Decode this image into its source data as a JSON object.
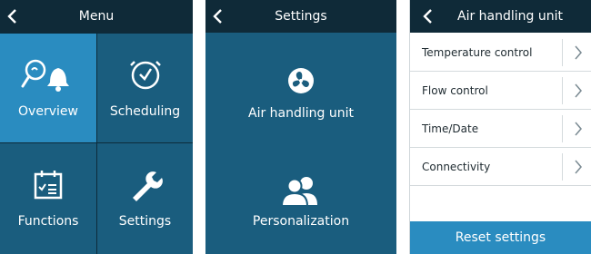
{
  "menu_screen": {
    "title": "Menu",
    "tiles": [
      {
        "label": "Overview",
        "icon": "overview-icon",
        "selected": true
      },
      {
        "label": "Scheduling",
        "icon": "clock-icon"
      },
      {
        "label": "Functions",
        "icon": "calendar-list-icon"
      },
      {
        "label": "Settings",
        "icon": "wrench-icon"
      }
    ]
  },
  "settings_screen": {
    "title": "Settings",
    "tiles": [
      {
        "label": "Air handling unit",
        "icon": "fan-icon"
      },
      {
        "label": "Personalization",
        "icon": "users-icon"
      }
    ]
  },
  "ahu_screen": {
    "title": "Air handling unit",
    "items": [
      {
        "label": "Temperature control"
      },
      {
        "label": "Flow control"
      },
      {
        "label": "Time/Date"
      },
      {
        "label": "Connectivity"
      }
    ],
    "reset_label": "Reset settings"
  },
  "colors": {
    "dark_bg": "#0d2b3a",
    "tile_bg": "#1a5d7e",
    "accent": "#2a8cc0"
  }
}
